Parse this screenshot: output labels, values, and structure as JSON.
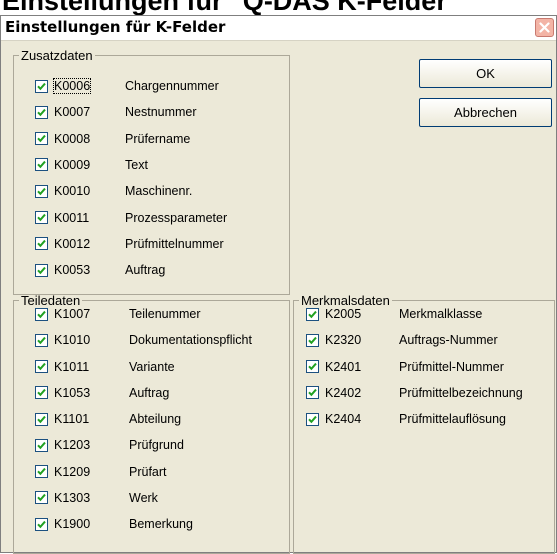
{
  "page_heading": "Einstellungen für \"Q-DAS K-Felder\"",
  "dialog": {
    "title": "Einstellungen für K-Felder",
    "ok_label": "OK",
    "cancel_label": "Abbrechen"
  },
  "groups": {
    "zusatzdaten": {
      "legend": "Zusatzdaten",
      "items": [
        {
          "code": "K0006",
          "label": "Chargennummer",
          "checked": true
        },
        {
          "code": "K0007",
          "label": "Nestnummer",
          "checked": true
        },
        {
          "code": "K0008",
          "label": "Prüfername",
          "checked": true
        },
        {
          "code": "K0009",
          "label": "Text",
          "checked": true
        },
        {
          "code": "K0010",
          "label": "Maschinenr.",
          "checked": true
        },
        {
          "code": "K0011",
          "label": "Prozessparameter",
          "checked": true
        },
        {
          "code": "K0012",
          "label": "Prüfmittelnummer",
          "checked": true
        },
        {
          "code": "K0053",
          "label": "Auftrag",
          "checked": true
        }
      ]
    },
    "teiledaten": {
      "legend": "Teiledaten",
      "items": [
        {
          "code": "K1007",
          "label": "Teilenummer",
          "checked": true
        },
        {
          "code": "K1010",
          "label": "Dokumentationspflicht",
          "checked": true
        },
        {
          "code": "K1011",
          "label": "Variante",
          "checked": true
        },
        {
          "code": "K1053",
          "label": "Auftrag",
          "checked": true
        },
        {
          "code": "K1101",
          "label": "Abteilung",
          "checked": true
        },
        {
          "code": "K1203",
          "label": "Prüfgrund",
          "checked": true
        },
        {
          "code": "K1209",
          "label": "Prüfart",
          "checked": true
        },
        {
          "code": "K1303",
          "label": "Werk",
          "checked": true
        },
        {
          "code": "K1900",
          "label": "Bemerkung",
          "checked": true
        }
      ]
    },
    "merkmalsdaten": {
      "legend": "Merkmalsdaten",
      "items": [
        {
          "code": "K2005",
          "label": "Merkmalklasse",
          "checked": true
        },
        {
          "code": "K2320",
          "label": "Auftrags-Nummer",
          "checked": true
        },
        {
          "code": "K2401",
          "label": "Prüfmittel-Nummer",
          "checked": true
        },
        {
          "code": "K2402",
          "label": "Prüfmittelbezeichnung",
          "checked": true
        },
        {
          "code": "K2404",
          "label": "Prüfmittelauflösung",
          "checked": true
        }
      ]
    }
  },
  "colors": {
    "dialog_bg": "#ece9d8",
    "checkbox_border": "#1c5180",
    "close_button": "#f3b4a6"
  },
  "icons": {
    "close": "close-x-icon",
    "checkbox": "checkmark-icon"
  }
}
